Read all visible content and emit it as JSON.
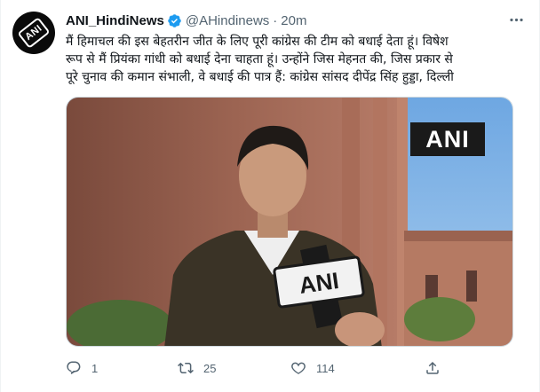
{
  "tweet": {
    "author_name": "ANI_HindiNews",
    "handle": "@AHindinews",
    "separator": "·",
    "time": "20m",
    "avatar_logo_text": "ANI",
    "text_lines": [
      "मैं हिमाचल की इस बेहतरीन जीत के लिए पूरी कांग्रेस की टीम को बधाई देता हूं। विषेश",
      "रूप से मैं प्रियंका गांधी को बधाई देना चाहता हूं। उन्होंने जिस मेहनत की,  जिस प्रकार से",
      "पूरे चुनाव की कमान संभाली, वे बधाई की पात्र हैं: कांग्रेस सांसद दीपेंद्र सिंह हुड्डा, दिल्ली"
    ],
    "media": {
      "watermark": "ANI",
      "mic_label": "ANI"
    },
    "actions": {
      "reply": {
        "icon": "reply-icon",
        "count": "1"
      },
      "retweet": {
        "icon": "retweet-icon",
        "count": "25"
      },
      "like": {
        "icon": "heart-icon",
        "count": "114"
      },
      "share": {
        "icon": "share-icon",
        "count": ""
      }
    },
    "colors": {
      "verified": "#1d9bf0",
      "secondary_text": "#536471",
      "primary_text": "#0f1419"
    }
  }
}
